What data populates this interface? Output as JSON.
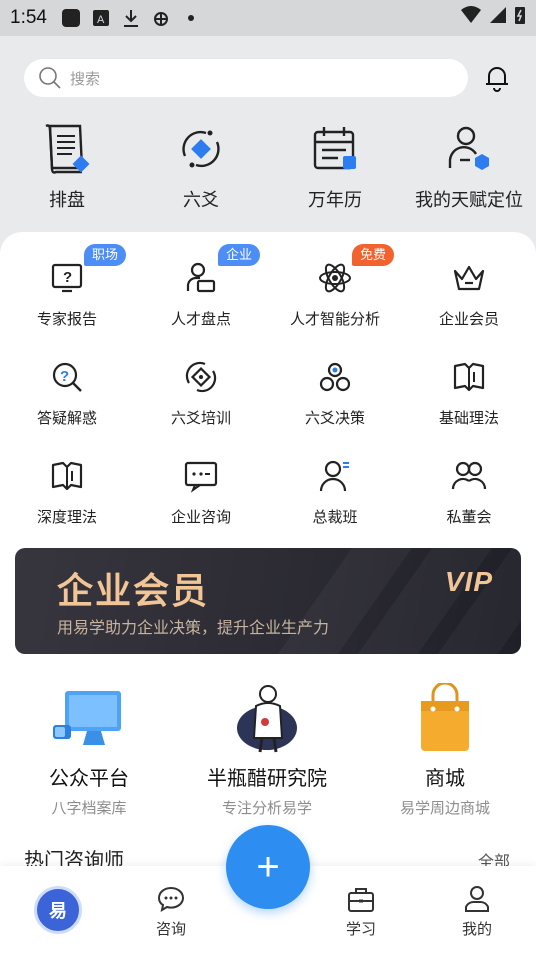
{
  "status_bar": {
    "time": "1:54"
  },
  "search": {
    "placeholder": "搜索"
  },
  "top_nav": [
    {
      "label": "排盘",
      "icon": "scroll-icon"
    },
    {
      "label": "六爻",
      "icon": "cycle-diamond-icon"
    },
    {
      "label": "万年历",
      "icon": "calendar-icon"
    },
    {
      "label": "我的天赋定位",
      "icon": "user-hexagon-icon"
    }
  ],
  "grid": [
    {
      "label": "专家报告",
      "icon": "report-icon",
      "badge": "职场",
      "badge_color": "#4c8df6"
    },
    {
      "label": "人才盘点",
      "icon": "person-desk-icon",
      "badge": "企业",
      "badge_color": "#4c8df6"
    },
    {
      "label": "人才智能分析",
      "icon": "atom-icon",
      "badge": "免费",
      "badge_color": "#f2622e"
    },
    {
      "label": "企业会员",
      "icon": "crown-icon"
    },
    {
      "label": "答疑解惑",
      "icon": "question-search-icon"
    },
    {
      "label": "六爻培训",
      "icon": "cycle-diamond-icon"
    },
    {
      "label": "六爻决策",
      "icon": "circles-icon"
    },
    {
      "label": "基础理法",
      "icon": "book-icon"
    },
    {
      "label": "深度理法",
      "icon": "book-icon"
    },
    {
      "label": "企业咨询",
      "icon": "chat-dots-icon"
    },
    {
      "label": "总裁班",
      "icon": "person-icon"
    },
    {
      "label": "私董会",
      "icon": "group-icon"
    }
  ],
  "banner": {
    "title": "企业会员",
    "subtitle": "用易学助力企业决策，提升企业生产力",
    "badge": "VIP"
  },
  "services": [
    {
      "title": "公众平台",
      "subtitle": "八字档案库",
      "icon": "monitor-icon"
    },
    {
      "title": "半瓶醋研究院",
      "subtitle": "专注分析易学",
      "icon": "figure-logo-icon"
    },
    {
      "title": "商城",
      "subtitle": "易学周边商城",
      "icon": "shopping-bag-icon"
    }
  ],
  "hot_section": {
    "title": "热门咨询师",
    "all_label": "全部"
  },
  "tab_bar": {
    "home_logo_text": "易",
    "consult": "咨询",
    "fab": "+",
    "learn": "学习",
    "mine": "我的"
  },
  "colors": {
    "accent": "#2d8df0",
    "gold": "#f2c596",
    "badge_blue": "#4c8df6",
    "badge_orange": "#f2622e"
  }
}
